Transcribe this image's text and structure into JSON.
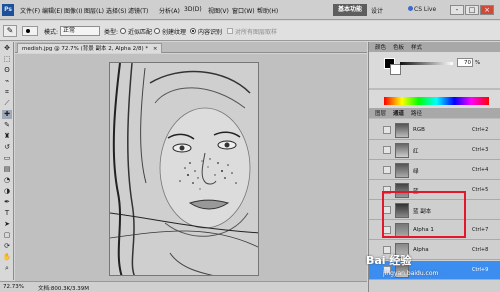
{
  "app": {
    "logo": "Ps"
  },
  "menubar": {
    "items": [
      "文件(F)",
      "编辑(E)",
      "图像(I)",
      "图层(L)",
      "选择(S)",
      "滤镜(T)",
      "分析(A)",
      "3D(D)",
      "视图(V)",
      "窗口(W)",
      "帮助(H)"
    ],
    "zoom": "72.7",
    "workspace": "基本功能",
    "design": "设计",
    "cslive": "CS Live",
    "win_min": "-",
    "win_max": "□",
    "win_close": "×"
  },
  "options": {
    "mode_label": "模式:",
    "mode_value": "正常",
    "type_label": "类型:",
    "radio_approx": "近似匹配",
    "radio_texture": "创建纹理",
    "radio_content": "内容识别",
    "sample_all": "对所有图层取样"
  },
  "document": {
    "tab_title": "medish.jpg @ 72.7% (背景 副本 2, Alpha 2/8) *",
    "tab_close": "×"
  },
  "status": {
    "zoom": "72.73%",
    "docsize": "文档:800.3K/3.39M"
  },
  "panels": {
    "tabs": [
      "颜色",
      "色板",
      "样式"
    ],
    "k_value": "70",
    "k_unit": "%",
    "adj_tabs": [
      "图层",
      "通道",
      "路径"
    ]
  },
  "channels": [
    {
      "name": "RGB",
      "key": "Ctrl+2",
      "selected": false
    },
    {
      "name": "红",
      "key": "Ctrl+3",
      "selected": false
    },
    {
      "name": "绿",
      "key": "Ctrl+4",
      "selected": false
    },
    {
      "name": "蓝",
      "key": "Ctrl+5",
      "selected": false
    },
    {
      "name": "蓝 副本",
      "key": "",
      "selected": false
    },
    {
      "name": "Alpha 1",
      "key": "Ctrl+7",
      "selected": false
    },
    {
      "name": "Alpha",
      "key": "Ctrl+8",
      "selected": false
    },
    {
      "name": "",
      "key": "Ctrl+9",
      "selected": true
    }
  ],
  "watermark": {
    "brand": "Bai 经验",
    "url": "jingyan.baidu.com"
  },
  "colors": {
    "accent": "#3c8df0",
    "highlight": "#e3162b",
    "ps_blue": "#1e4f9a"
  }
}
